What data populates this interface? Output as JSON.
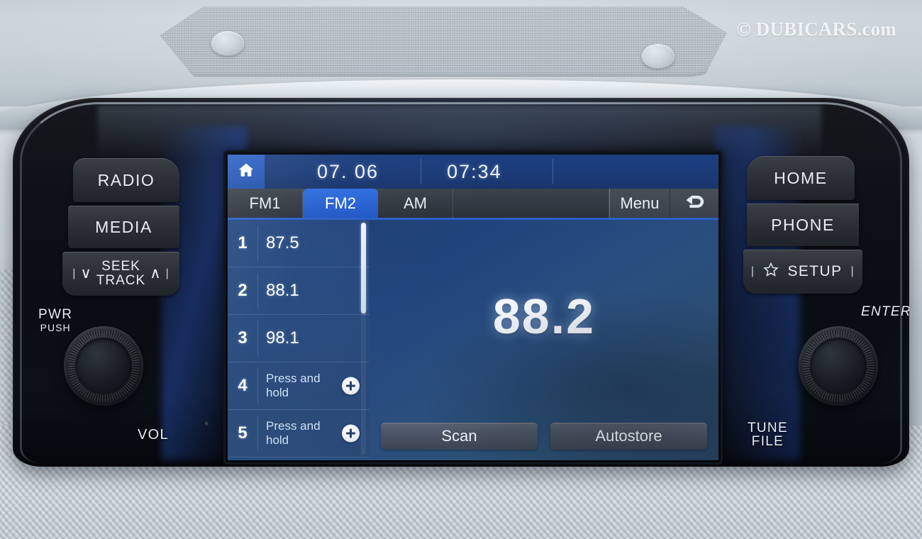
{
  "watermark": "© DUBICARS.com",
  "screen": {
    "status_bar": {
      "home_icon": "home-icon",
      "date": "07. 06",
      "time": "07:34"
    },
    "tabs": [
      {
        "label": "FM1",
        "active": false
      },
      {
        "label": "FM2",
        "active": true
      },
      {
        "label": "AM",
        "active": false
      }
    ],
    "menu_label": "Menu",
    "back_icon": "back-arrow-icon",
    "presets": [
      {
        "number": "1",
        "label": "87.5",
        "empty": false
      },
      {
        "number": "2",
        "label": "88.1",
        "empty": false
      },
      {
        "number": "3",
        "label": "98.1",
        "empty": false
      },
      {
        "number": "4",
        "label": "Press and hold",
        "empty": true
      },
      {
        "number": "5",
        "label": "Press and hold",
        "empty": true
      }
    ],
    "frequency": "88.2",
    "actions": [
      {
        "label": "Scan"
      },
      {
        "label": "Autostore"
      }
    ]
  },
  "hard_buttons": {
    "left": [
      {
        "id": "radio",
        "label": "RADIO"
      },
      {
        "id": "media",
        "label": "MEDIA"
      },
      {
        "id": "seek",
        "label_top": "SEEK",
        "label_bottom": "TRACK"
      }
    ],
    "right": [
      {
        "id": "home",
        "label": "HOME"
      },
      {
        "id": "phone",
        "label": "PHONE"
      },
      {
        "id": "setup",
        "label": "SETUP",
        "icon": "star-icon"
      }
    ]
  },
  "knob_labels": {
    "power": "PWR",
    "power_sub": "PUSH",
    "volume": "VOL",
    "enter": "ENTER",
    "tune": "TUNE",
    "tune_sub": "FILE"
  },
  "colors": {
    "accent_blue": "#2a5fc8",
    "screen_blue": "#23477f",
    "tab_active": "#2f6ee0",
    "bezel_black": "#0a0d13",
    "dash_grey": "#c7d0d7"
  }
}
